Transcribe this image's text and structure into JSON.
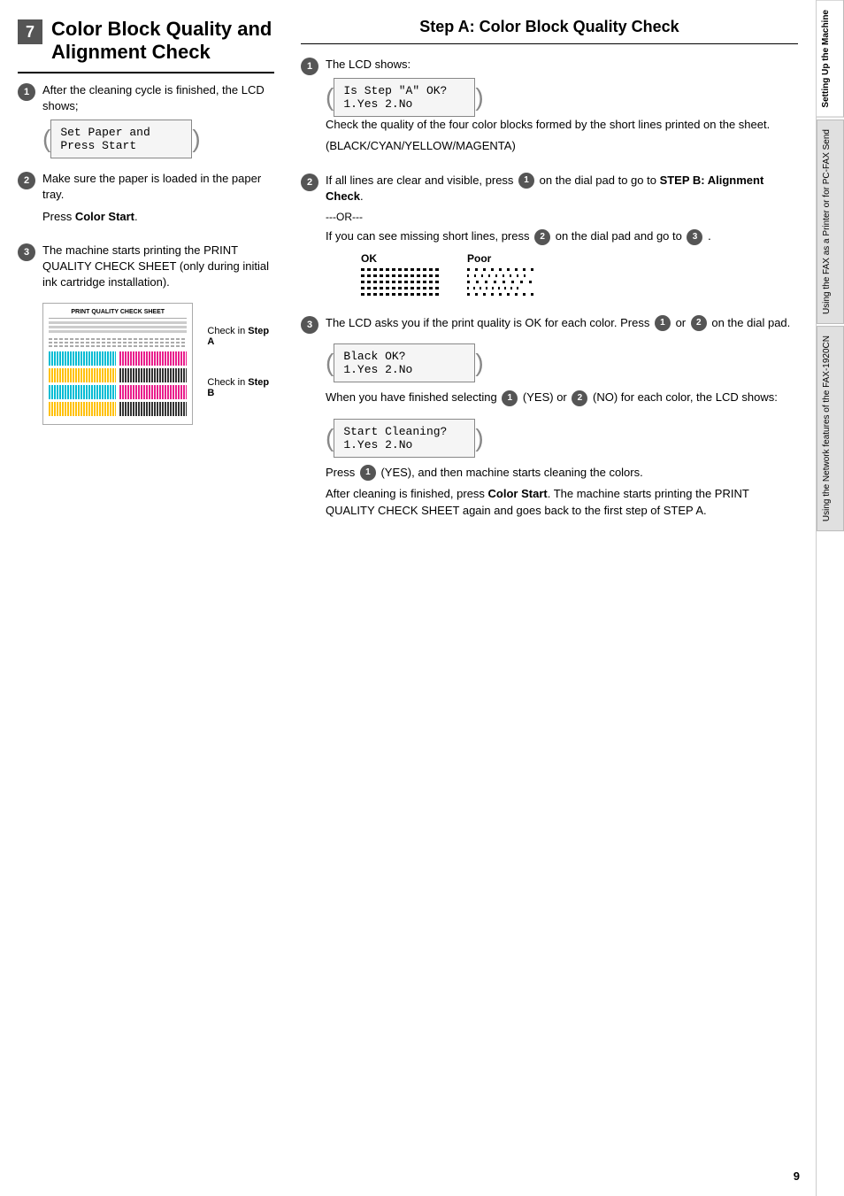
{
  "page": {
    "number": "9",
    "title": "Color Block Quality and Alignment Check"
  },
  "section": {
    "badge": "7",
    "title_line1": "Color Block Quality and",
    "title_line2": "Alignment Check"
  },
  "left": {
    "step1": {
      "num": "1",
      "text": "After the cleaning cycle is finished, the LCD shows;",
      "lcd_line1": "Set Paper and",
      "lcd_line2": "Press Start"
    },
    "step2": {
      "num": "2",
      "text_before": "Make sure the paper is loaded in the paper tray.",
      "text_press": "Press ",
      "text_bold": "Color Start",
      "text_period": "."
    },
    "step3": {
      "num": "3",
      "text": "The machine starts printing the PRINT QUALITY CHECK SHEET (only during initial ink cartridge installation).",
      "pqcs_title": "PRINT QUALITY CHECK SHEET",
      "check_a_label": "Check in ",
      "check_a_bold": "Step A",
      "check_b_label": "Check in ",
      "check_b_bold": "Step B"
    }
  },
  "right": {
    "step_a_heading": "Step A:  Color Block Quality Check",
    "step1": {
      "num": "1",
      "text": "The LCD shows:",
      "lcd_line1": "Is Step \"A\" OK?",
      "lcd_line2": "1.Yes 2.No",
      "desc": "Check the quality of the four color blocks formed by the short lines printed on the sheet.",
      "desc2": "(BLACK/CYAN/YELLOW/MAGENTA)"
    },
    "step2": {
      "num": "2",
      "text_start": "If all lines are clear and visible, press ",
      "circle1": "1",
      "text_mid": " on the dial pad to go to ",
      "text_bold": "STEP B: Alignment Check",
      "text_end": ".",
      "or_text": "---OR---",
      "text2_start": "If you can see missing short lines, press ",
      "circle2": "2",
      "text2_mid": " on the dial pad and go to ",
      "circle3": "3",
      "text2_end": ".",
      "ok_label": "OK",
      "poor_label": "Poor"
    },
    "step3": {
      "num": "3",
      "text_start": "The LCD asks you if the print quality is OK for each color. Press ",
      "circle1": "1",
      "text_mid": " or ",
      "circle2": "2",
      "text_end": " on the dial pad.",
      "lcd_line1": "Black OK?",
      "lcd_line2": "1.Yes 2.No",
      "desc1_start": "When you have finished selecting ",
      "circle_yes": "1",
      "desc1_mid": " (YES) or ",
      "circle_no": "2",
      "desc1_end": " (NO) for each color, the LCD shows:",
      "lcd2_line1": "Start Cleaning?",
      "lcd2_line2": "1.Yes 2.No",
      "desc2_start": "Press ",
      "circle_press": "1",
      "desc2_mid": " (YES), and then machine starts cleaning the colors.",
      "desc3": "After cleaning is finished, press ",
      "desc3_bold": "Color Start",
      "desc3_end": ". The machine starts printing the PRINT QUALITY CHECK SHEET again and goes back to the first step of STEP A."
    }
  },
  "tabs": [
    {
      "label": "Setting Up the Machine",
      "active": true
    },
    {
      "label": "Using the FAX as a Printer or for PC-FAX Send",
      "active": false
    },
    {
      "label": "Using the Network features of the FAX-1920CN",
      "active": false
    }
  ]
}
